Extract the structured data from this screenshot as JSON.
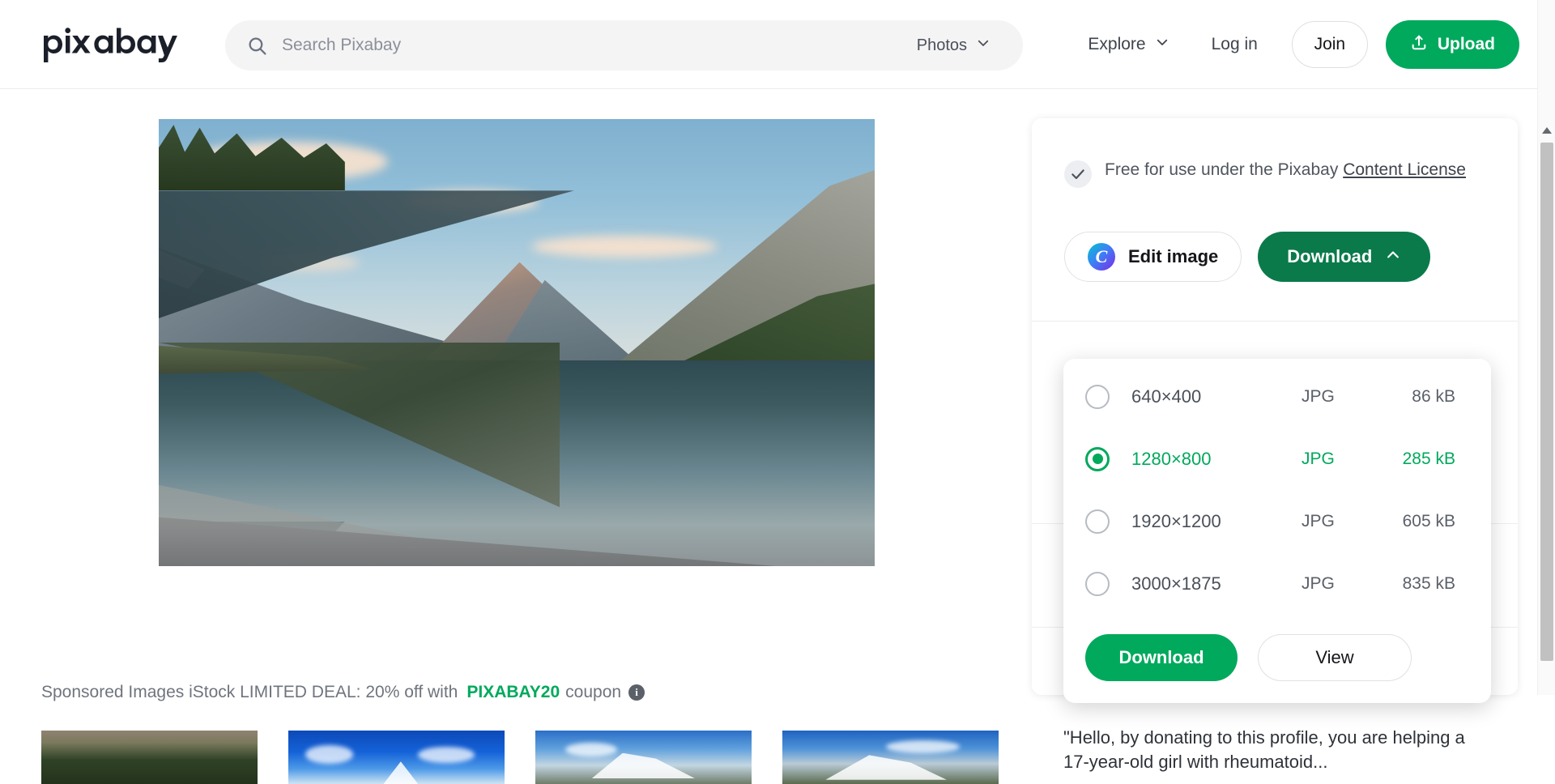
{
  "header": {
    "logo_text": "pixabay",
    "search": {
      "placeholder": "Search Pixabay",
      "value": "",
      "icon": "search-icon",
      "type_label": "Photos",
      "type_chevron": "chevron-down-icon"
    },
    "nav": {
      "explore_label": "Explore",
      "explore_chevron": "chevron-down-icon",
      "login_label": "Log in",
      "join_label": "Join",
      "upload_label": "Upload",
      "upload_icon": "upload-icon"
    }
  },
  "main": {
    "image_alt": "mountain lake reflection landscape",
    "sponsored": {
      "prefix": "Sponsored Images iStock LIMITED DEAL: 20% off with",
      "coupon": "PIXABAY20",
      "suffix": "coupon",
      "info_icon": "info-icon",
      "info_glyph": "i"
    },
    "thumbnails": [
      {
        "alt": "forest below mountain ridge"
      },
      {
        "alt": "matterhorn peak under blue sky"
      },
      {
        "alt": "snowy sierra peaks and lake"
      },
      {
        "alt": "alpine mountain range with snow"
      }
    ]
  },
  "sidebar": {
    "license": {
      "check_icon": "check-icon",
      "text_before": "Free for use under the Pixabay",
      "link_label": "Content License"
    },
    "edit_button": {
      "label": "Edit image",
      "icon": "canva-icon",
      "icon_glyph": "C"
    },
    "download_button": {
      "label": "Download",
      "chevron": "chevron-up-icon"
    },
    "donation_quote": "\"Hello, by donating to this profile, you are helping a 17-year-old girl with rheumatoid..."
  },
  "download_dropdown": {
    "columns": [
      "size",
      "format",
      "filesize"
    ],
    "options": [
      {
        "size": "640×400",
        "format": "JPG",
        "filesize": "86 kB",
        "selected": false
      },
      {
        "size": "1280×800",
        "format": "JPG",
        "filesize": "285 kB",
        "selected": true
      },
      {
        "size": "1920×1200",
        "format": "JPG",
        "filesize": "605 kB",
        "selected": false
      },
      {
        "size": "3000×1875",
        "format": "JPG",
        "filesize": "835 kB",
        "selected": false
      }
    ],
    "download_label": "Download",
    "view_label": "View"
  },
  "colors": {
    "brand_green": "#00a95c",
    "dark_green": "#0a7a4a",
    "text": "#2b2d31",
    "muted": "#6f747d",
    "panel_bg": "#ffffff",
    "search_bg": "#f4f4f5"
  },
  "scrollbar": {
    "up_icon": "scroll-up-arrow-icon"
  }
}
